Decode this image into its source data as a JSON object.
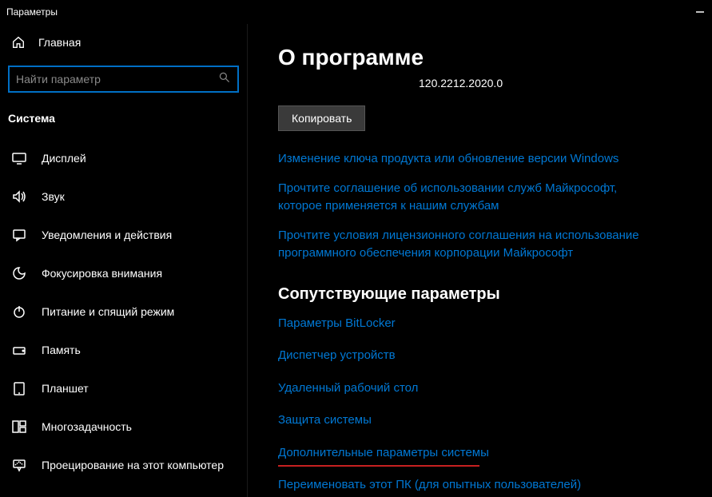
{
  "titlebar": {
    "title": "Параметры"
  },
  "sidebar": {
    "home_label": "Главная",
    "search_placeholder": "Найти параметр",
    "section_label": "Система",
    "items": [
      {
        "label": "Дисплей"
      },
      {
        "label": "Звук"
      },
      {
        "label": "Уведомления и действия"
      },
      {
        "label": "Фокусировка внимания"
      },
      {
        "label": "Питание и спящий режим"
      },
      {
        "label": "Память"
      },
      {
        "label": "Планшет"
      },
      {
        "label": "Многозадачность"
      },
      {
        "label": "Проецирование на этот компьютер"
      }
    ]
  },
  "main": {
    "heading": "О программе",
    "version": "120.2212.2020.0",
    "copy_label": "Копировать",
    "links": [
      "Изменение ключа продукта или обновление версии Windows",
      "Прочтите соглашение об использовании служб Майкрософт, которое применяется к нашим службам",
      "Прочтите условия лицензионного соглашения на использование программного обеспечения корпорации Майкрософт"
    ],
    "related_heading": "Сопутствующие параметры",
    "related_links": [
      "Параметры BitLocker",
      "Диспетчер устройств",
      "Удаленный рабочий стол",
      "Защита системы",
      "Дополнительные параметры системы",
      "Переименовать этот ПК (для опытных пользователей)"
    ]
  }
}
